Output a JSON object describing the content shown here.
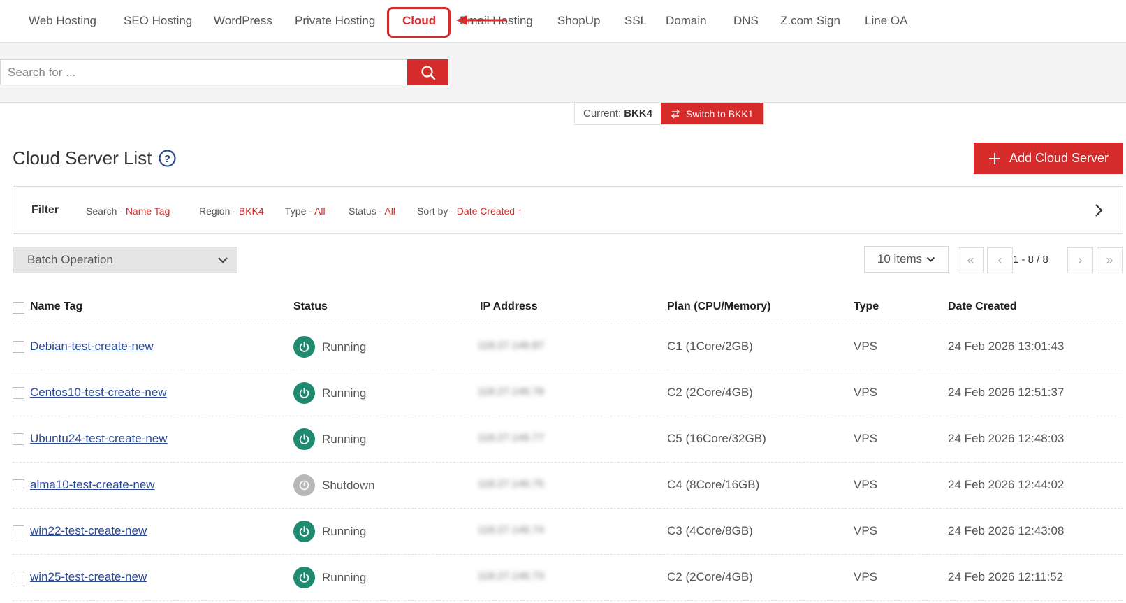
{
  "nav": {
    "items": [
      "Web Hosting",
      "SEO Hosting",
      "WordPress",
      "Private Hosting",
      "Cloud",
      "Email Hosting",
      "ShopUp",
      "SSL",
      "Domain",
      "DNS",
      "Z.com Sign",
      "Line OA"
    ],
    "active": "Cloud"
  },
  "search": {
    "placeholder": "Search for ..."
  },
  "region": {
    "current_label": "Current:",
    "current_value": "BKK4",
    "switch_label": "Switch to BKK1"
  },
  "page": {
    "title": "Cloud Server List",
    "add_button": "Add Cloud Server"
  },
  "filter": {
    "label": "Filter",
    "chips": [
      {
        "key": "Search - ",
        "value": "Name Tag"
      },
      {
        "key": "Region - ",
        "value": "BKK4"
      },
      {
        "key": "Type - ",
        "value": "All"
      },
      {
        "key": "Status - ",
        "value": "All"
      },
      {
        "key": "Sort by - ",
        "value": "Date Created ↑"
      }
    ]
  },
  "batch": {
    "label": "Batch Operation"
  },
  "pagination": {
    "items_per_page": "10 items",
    "range": "1 - 8 / 8"
  },
  "table": {
    "headers": [
      "Name Tag",
      "Status",
      "IP Address",
      "Plan (CPU/Memory)",
      "Type",
      "Date Created"
    ],
    "rows": [
      {
        "name": "Debian-test-create-new",
        "status": "Running",
        "ip": "118.27.146.87",
        "plan": "C1 (1Core/2GB)",
        "type": "VPS",
        "date": "24 Feb 2026 13:01:43"
      },
      {
        "name": "Centos10-test-create-new",
        "status": "Running",
        "ip": "118.27.146.78",
        "plan": "C2 (2Core/4GB)",
        "type": "VPS",
        "date": "24 Feb 2026 12:51:37"
      },
      {
        "name": "Ubuntu24-test-create-new",
        "status": "Running",
        "ip": "118.27.146.77",
        "plan": "C5 (16Core/32GB)",
        "type": "VPS",
        "date": "24 Feb 2026 12:48:03"
      },
      {
        "name": "alma10-test-create-new",
        "status": "Shutdown",
        "ip": "118.27.146.75",
        "plan": "C4 (8Core/16GB)",
        "type": "VPS",
        "date": "24 Feb 2026 12:44:02"
      },
      {
        "name": "win22-test-create-new",
        "status": "Running",
        "ip": "118.27.146.74",
        "plan": "C3 (4Core/8GB)",
        "type": "VPS",
        "date": "24 Feb 2026 12:43:08"
      },
      {
        "name": "win25-test-create-new",
        "status": "Running",
        "ip": "118.27.146.73",
        "plan": "C2 (2Core/4GB)",
        "type": "VPS",
        "date": "24 Feb 2026 12:11:52"
      }
    ]
  },
  "colors": {
    "accent": "#d52b2b",
    "running": "#1f8a70",
    "shutdown": "#b8b8b8",
    "link": "#2c4a93"
  },
  "icons": [
    "search-icon",
    "switch-icon",
    "help-icon",
    "plus-icon",
    "chevron-right-icon",
    "chevron-down-icon",
    "power-icon",
    "first-page-icon",
    "prev-page-icon",
    "next-page-icon",
    "last-page-icon",
    "arrow-annotation-icon"
  ]
}
